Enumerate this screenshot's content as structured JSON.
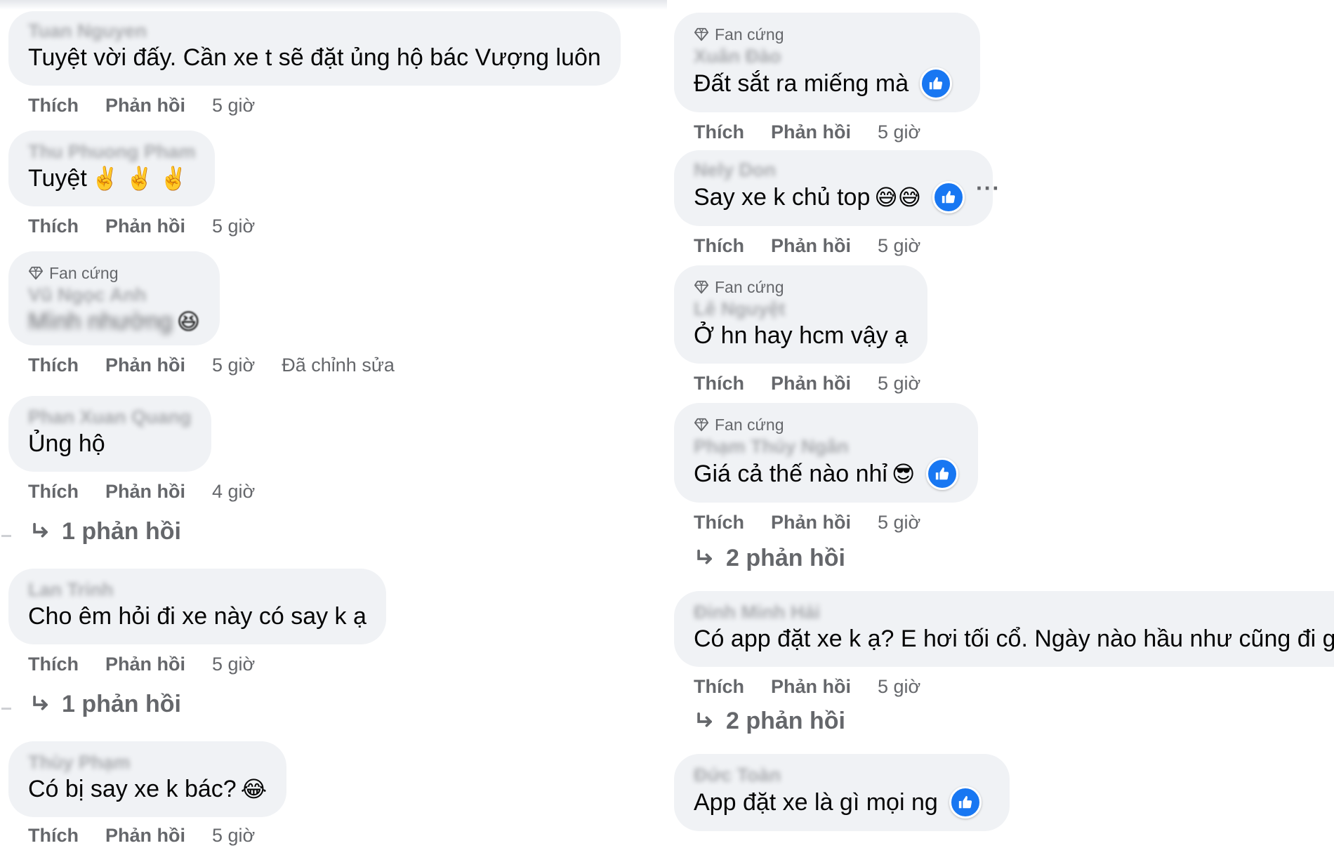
{
  "badge_label": "Fan cứng",
  "action_like": "Thích",
  "action_reply": "Phản hồi",
  "colors": {
    "bubble": "#f0f2f5",
    "muted": "#65676b",
    "like_blue": "#1877f2"
  },
  "left": [
    {
      "author": "Tuan Nguyen",
      "text": "Tuyệt vời đấy. Cần xe t sẽ đặt ủng hộ bác Vượng luôn",
      "time": "5 giờ"
    },
    {
      "author": "Thu Phuong Pham",
      "text": "Tuyệt",
      "emoji": "✌️ ✌️ ✌️",
      "time": "5 giờ"
    },
    {
      "author": "Vũ Ngọc Anh",
      "text": "Mình nhường",
      "emoji": "😆",
      "time": "5 giờ",
      "edited": "Đã chỉnh sửa"
    },
    {
      "author": "Phan Xuan Quang",
      "text": "Ủng hộ",
      "time": "4 giờ",
      "replies": "1 phản hồi"
    },
    {
      "author": "Lan Trinh",
      "text": "Cho êm hỏi đi xe này có say k ạ",
      "time": "5 giờ",
      "replies": "1 phản hồi"
    },
    {
      "author": "Thùy Phạm",
      "text": "Có bị say xe k bác?",
      "emoji": "😂",
      "time": "5 giờ"
    }
  ],
  "right": [
    {
      "author": "Xuân Đào",
      "text": "Đất sắt ra miếng mà",
      "time": "5 giờ"
    },
    {
      "author": "Nely Don",
      "text": "Say xe k chủ top",
      "emoji": "😅😅",
      "time": "5 giờ"
    },
    {
      "author": "Lê Nguyệt",
      "text": "Ở hn hay hcm vậy ạ",
      "time": "5 giờ"
    },
    {
      "author": "Phạm Thúy Ngân",
      "text": "Giá cả thế nào nhỉ",
      "emoji": "😎",
      "time": "5 giờ",
      "replies": "2 phản hồi"
    },
    {
      "author": "Đinh Minh Hải",
      "text": "Có app đặt xe k ạ? E hơi tối cổ. Ngày nào hầu như cũng đi grab",
      "time": "5 giờ",
      "replies": "2 phản hồi"
    },
    {
      "author": "Đức Toàn",
      "text": "App đặt xe là gì mọi ng"
    }
  ]
}
